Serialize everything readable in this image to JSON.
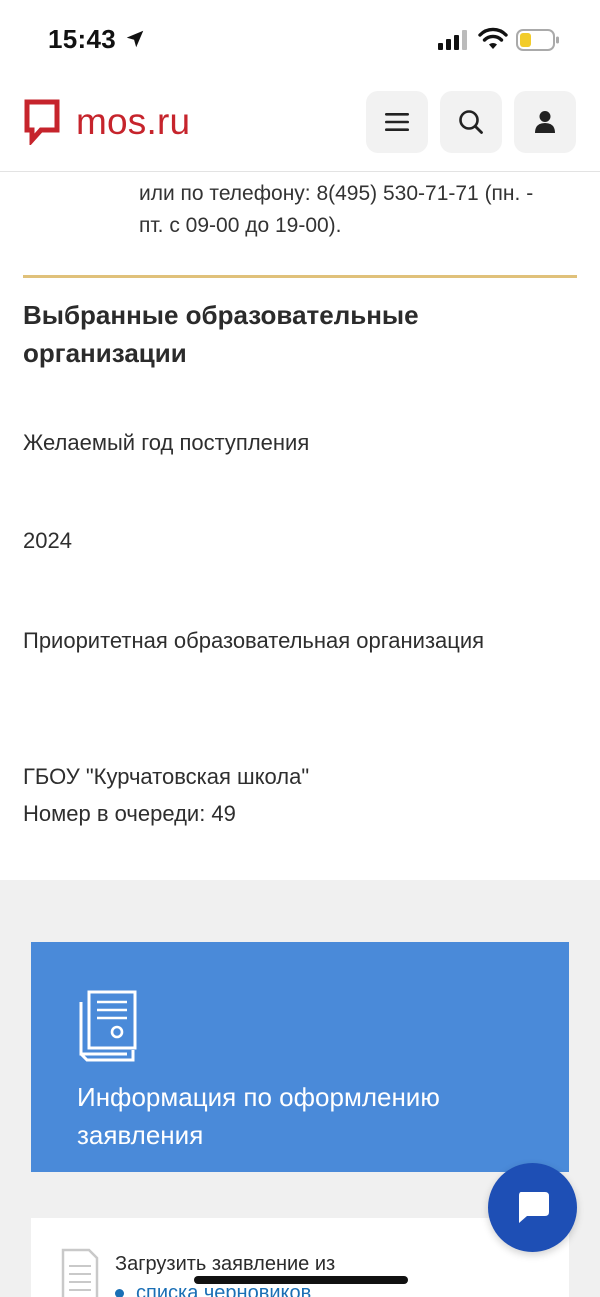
{
  "status_bar": {
    "time": "15:43",
    "icons": [
      "location-arrow-icon",
      "cellular-signal-icon",
      "wifi-icon",
      "battery-icon"
    ]
  },
  "header": {
    "logo_text": "mos.ru",
    "brand_color": "#c6242c",
    "buttons": [
      "menu-icon",
      "search-icon",
      "user-icon"
    ]
  },
  "content": {
    "cut_text": "или по телефону: 8(495) 530-71-71 (пн. - пт. с 09-00 до 19-00).",
    "section_title": "Выбранные образовательные организации",
    "year_label": "Желаемый год поступления",
    "year_value": "2024",
    "priority_label": "Приоритетная образовательная организация",
    "school_name": "ГБОУ \"Курчатовская школа\"",
    "queue_text": "Номер в очереди: 49",
    "divider_color": "#e0c17a"
  },
  "info_card": {
    "text": "Информация по оформлению заявления",
    "color": "#4a8ad9"
  },
  "upload_card": {
    "text": "Загрузить заявление из",
    "link": "списка черновиков"
  },
  "chat_button": {
    "icon": "chat-bubble-icon",
    "color": "#1e4fb5"
  }
}
